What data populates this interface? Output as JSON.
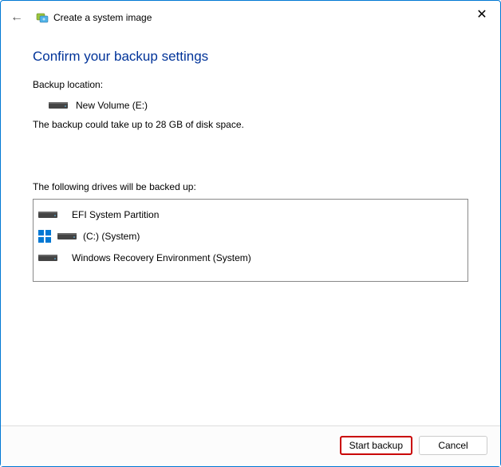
{
  "titlebar": {
    "wizard_title": "Create a system image"
  },
  "content": {
    "heading": "Confirm your backup settings",
    "backup_location_label": "Backup location:",
    "backup_location_value": "New Volume (E:)",
    "size_note": "The backup could take up to 28 GB of disk space.",
    "drives_label": "The following drives will be backed up:",
    "drives": [
      {
        "name": "EFI System Partition"
      },
      {
        "name": "(C:) (System)"
      },
      {
        "name": "Windows Recovery Environment (System)"
      }
    ]
  },
  "footer": {
    "start_label": "Start backup",
    "cancel_label": "Cancel"
  }
}
